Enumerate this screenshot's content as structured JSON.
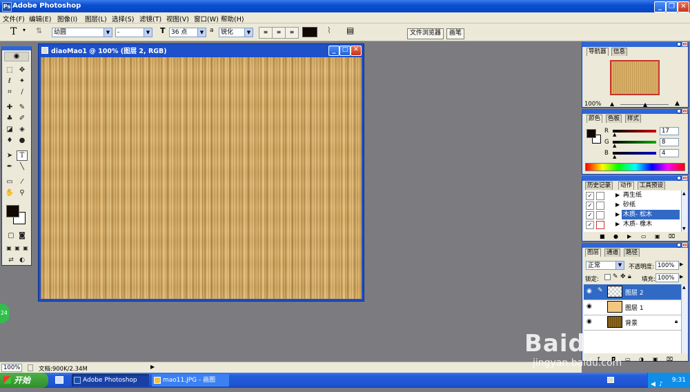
{
  "app": {
    "title": "Adobe Photoshop",
    "logo_text": "Ps"
  },
  "menu": [
    "文件(F)",
    "编辑(E)",
    "图像(I)",
    "图层(L)",
    "选择(S)",
    "滤镜(T)",
    "视图(V)",
    "窗口(W)",
    "帮助(H)"
  ],
  "options": {
    "tool_glyph": "T",
    "font_family": "幼圆",
    "font_style": "-",
    "font_size": "36 点",
    "aa_label": "a",
    "antialias": "锐化",
    "file_browser_tab": "文件浏览器",
    "brushes_tab": "画笔"
  },
  "document": {
    "title": "diaoMao1 @ 100% (图层 2, RGB)"
  },
  "navigator": {
    "tabs": [
      "导航器",
      "信息"
    ],
    "zoom": "100%"
  },
  "color": {
    "tabs": [
      "颜色",
      "色板",
      "样式"
    ],
    "r_label": "R",
    "g_label": "G",
    "b_label": "B",
    "r": "17",
    "g": "8",
    "b": "4"
  },
  "actions": {
    "tabs": [
      "历史记录",
      "动作",
      "工具预设"
    ],
    "items": [
      {
        "label": "再生纸",
        "selected": false
      },
      {
        "label": "砂纸",
        "selected": false
      },
      {
        "label": "木质- 松木",
        "selected": true
      },
      {
        "label": "木质- 橡木",
        "selected": false
      }
    ]
  },
  "layers": {
    "tabs": [
      "图层",
      "通道",
      "路径"
    ],
    "blend_mode": "正常",
    "opacity_label": "不透明度:",
    "opacity": "100%",
    "lock_label": "锁定:",
    "fill_label": "填充:",
    "fill": "100%",
    "items": [
      {
        "name": "图层 2",
        "selected": true
      },
      {
        "name": "图层 1",
        "selected": false
      },
      {
        "name": "背景",
        "selected": false
      }
    ]
  },
  "status": {
    "zoom": "100%",
    "doc_info": "文档:900K/2.34M"
  },
  "taskbar": {
    "start_label": "开始",
    "tasks": [
      "Adobe Photoshop",
      "mao11.JPG - 画图"
    ],
    "time": "9:31"
  },
  "watermark": {
    "logo": "Baidu经验",
    "url": "jingyan.baidu.com"
  },
  "side_badge": "24"
}
